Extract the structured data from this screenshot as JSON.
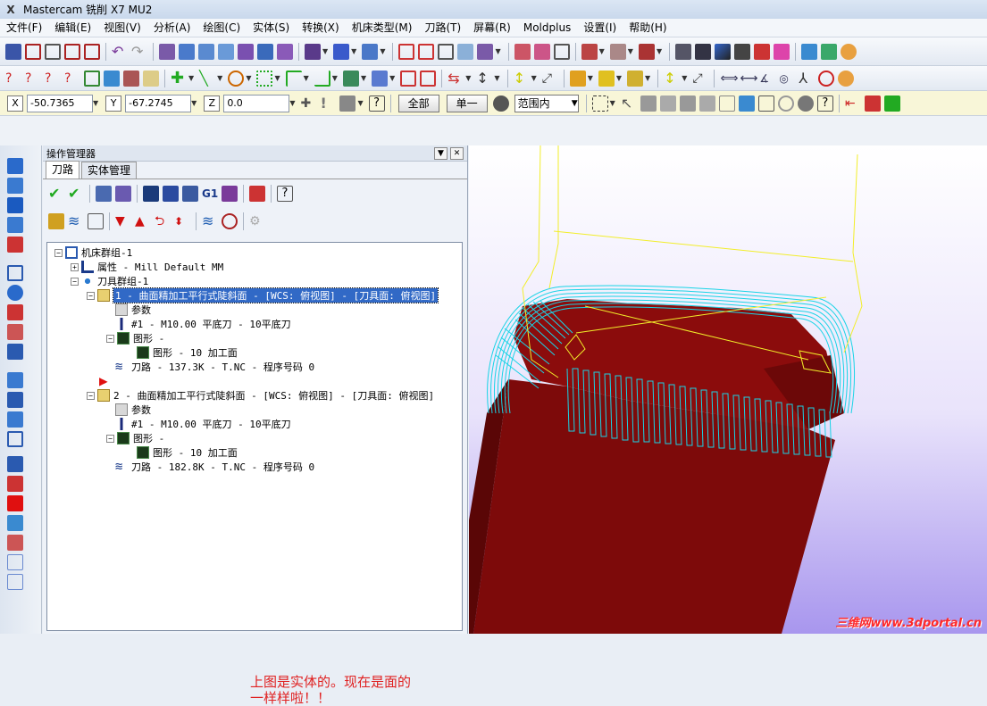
{
  "window": {
    "title": "Mastercam 铣削 X7 MU2"
  },
  "menu": [
    "文件(F)",
    "编辑(E)",
    "视图(V)",
    "分析(A)",
    "绘图(C)",
    "实体(S)",
    "转换(X)",
    "机床类型(M)",
    "刀路(T)",
    "屏幕(R)",
    "Moldplus",
    "设置(I)",
    "帮助(H)"
  ],
  "coords": {
    "x_label": "X",
    "x_value": "-50.7365",
    "y_label": "Y",
    "y_value": "-67.2745",
    "z_label": "Z",
    "z_value": "0.0"
  },
  "selection": {
    "all_label": "全部",
    "single_label": "单一",
    "range_value": "范围内"
  },
  "panel": {
    "title": "操作管理器",
    "tabs": [
      "刀路",
      "实体管理"
    ],
    "tree": {
      "root": "机床群组-1",
      "props": "属性 - Mill Default MM",
      "group": "刀具群组-1",
      "op1": {
        "label": "1 - 曲面精加工平行式陡斜面 - [WCS: 俯视图] - [刀具面: 俯视图]",
        "params": "参数",
        "tool": "#1 - M10.00 平底刀 - 10平底刀",
        "geom": "图形 -",
        "geom_child": "图形 - 10 加工面",
        "path": "刀路 - 137.3K - T.NC - 程序号码 0"
      },
      "op2": {
        "label": "2 - 曲面精加工平行式陡斜面 - [WCS: 俯视图] - [刀具面: 俯视图]",
        "params": "参数",
        "tool": "#1 - M10.00 平底刀 - 10平底刀",
        "geom": "图形 -",
        "geom_child": "图形 - 10 加工面",
        "path": "刀路 - 182.8K - T.NC - 程序号码 0"
      }
    }
  },
  "note": {
    "line1": "上图是实体的。现在是面的",
    "line2": "一样样啦！！"
  },
  "viewport": {
    "watermark": "三维网www.3dportal.cn"
  },
  "colors": {
    "solid": "#8b0c0c",
    "toolpath": "#19d4e6",
    "rapid": "#f2ee2a",
    "highlight": "#3169c6"
  }
}
